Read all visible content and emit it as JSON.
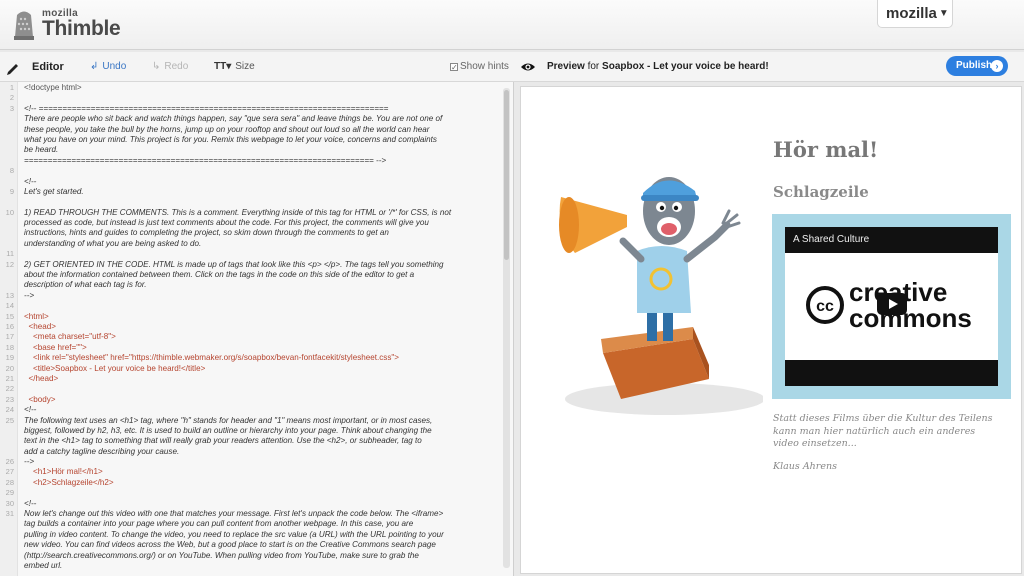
{
  "brand": {
    "small": "mozilla",
    "big": "Thimble",
    "menu": "mozilla"
  },
  "editor_toolbar": {
    "title": "Editor",
    "undo": "Undo",
    "redo": "Redo",
    "size": "Size",
    "size_glyph": "TT▾",
    "hints": "Show hints",
    "hints_checked": true
  },
  "preview_toolbar": {
    "label": "Preview",
    "for": "for",
    "page": "Soapbox - Let your voice be heard!",
    "publish": "Publish"
  },
  "code_lines": [
    {
      "n": "1",
      "text": "<!doctype html>",
      "kind": "plain"
    },
    {
      "n": "2",
      "text": "",
      "kind": "plain"
    },
    {
      "n": "3",
      "text": "<!-- ==========================================================================",
      "kind": "comment"
    },
    {
      "n": "",
      "text": "There are people who sit back and watch things happen, say \"que sera sera\" and leave things be. You are not one of",
      "kind": "comment"
    },
    {
      "n": "",
      "text": "these people, you take the bull by the horns, jump up on your rooftop and shout out loud so all the world can hear",
      "kind": "comment"
    },
    {
      "n": "",
      "text": "what you have on your mind. This project is for you. Remix this webpage to let your voice, concerns and complaints",
      "kind": "comment"
    },
    {
      "n": "",
      "text": "be heard.",
      "kind": "comment"
    },
    {
      "n": "",
      "text": "========================================================================== -->",
      "kind": "comment"
    },
    {
      "n": "8",
      "text": "",
      "kind": "plain"
    },
    {
      "n": "",
      "text": "<!--",
      "kind": "comment"
    },
    {
      "n": "9",
      "text": "Let's get started.",
      "kind": "comment"
    },
    {
      "n": "",
      "text": "",
      "kind": "plain"
    },
    {
      "n": "10",
      "text": "1) READ THROUGH THE COMMENTS. This is a comment. Everything inside of this tag for HTML or '/*' for CSS, is not",
      "kind": "comment"
    },
    {
      "n": "",
      "text": "processed as code, but instead is just text comments about the code. For this project, the comments will give you",
      "kind": "comment"
    },
    {
      "n": "",
      "text": "instructions, hints and guides to completing the project, so skim down through the comments to get an",
      "kind": "comment"
    },
    {
      "n": "",
      "text": "understanding of what you are being asked to do.",
      "kind": "comment"
    },
    {
      "n": "11",
      "text": "",
      "kind": "plain"
    },
    {
      "n": "12",
      "text": "2) GET ORIENTED IN THE CODE. HTML is made up of tags that look like this <p> </p>. The tags tell you something",
      "kind": "comment"
    },
    {
      "n": "",
      "text": "about the information contained between them. Click on the tags in the code on this side of the editor to get a",
      "kind": "comment"
    },
    {
      "n": "",
      "text": "description of what each tag is for.",
      "kind": "comment"
    },
    {
      "n": "13",
      "text": "-->",
      "kind": "comment"
    },
    {
      "n": "14",
      "text": "",
      "kind": "plain"
    },
    {
      "n": "15",
      "text": "<html>",
      "kind": "tag"
    },
    {
      "n": "16",
      "text": "  <head>",
      "kind": "tag"
    },
    {
      "n": "17",
      "text": "    <meta charset=\"utf-8\">",
      "kind": "tag"
    },
    {
      "n": "18",
      "text": "    <base href=\"\">",
      "kind": "tag"
    },
    {
      "n": "19",
      "text": "    <link rel=\"stylesheet\" href=\"https://thimble.webmaker.org/s/soapbox/bevan-fontfacekit/stylesheet.css\">",
      "kind": "tag"
    },
    {
      "n": "20",
      "text": "    <title>Soapbox - Let your voice be heard!</title>",
      "kind": "tag"
    },
    {
      "n": "21",
      "text": "  </head>",
      "kind": "tag"
    },
    {
      "n": "22",
      "text": "",
      "kind": "plain"
    },
    {
      "n": "23",
      "text": "  <body>",
      "kind": "tag"
    },
    {
      "n": "24",
      "text": "<!--",
      "kind": "comment"
    },
    {
      "n": "25",
      "text": "The following text uses an <h1> tag, where \"h\" stands for header and \"1\" means most important, or in most cases,",
      "kind": "comment"
    },
    {
      "n": "",
      "text": "biggest, followed by h2, h3, etc. It is used to build an outline or hierarchy into your page. Think about changing the",
      "kind": "comment"
    },
    {
      "n": "",
      "text": "text in the <h1> tag to something that will really grab your readers attention. Use the <h2>, or subheader, tag to",
      "kind": "comment"
    },
    {
      "n": "",
      "text": "add a catchy tagline describing your cause.",
      "kind": "comment"
    },
    {
      "n": "26",
      "text": "-->",
      "kind": "comment"
    },
    {
      "n": "27",
      "text": "    <h1>Hör mal!</h1>",
      "kind": "tag"
    },
    {
      "n": "28",
      "text": "    <h2>Schlagzeile</h2>",
      "kind": "tag"
    },
    {
      "n": "29",
      "text": "",
      "kind": "plain"
    },
    {
      "n": "30",
      "text": "<!--",
      "kind": "comment"
    },
    {
      "n": "31",
      "text": "Now let's change out this video with one that matches your message. First let's unpack the code below. The <iframe>",
      "kind": "comment"
    },
    {
      "n": "",
      "text": "tag builds a container into your page where you can pull content from another webpage. In this case, you are",
      "kind": "comment"
    },
    {
      "n": "",
      "text": "pulling in video content. To change the video, you need to replace the src value (a URL) with the URL pointing to your",
      "kind": "comment"
    },
    {
      "n": "",
      "text": "new video. You can find videos across the Web, but a good place to start is on the Creative Commons search page",
      "kind": "comment"
    },
    {
      "n": "",
      "text": "(http://search.creativecommons.org/) or on YouTube. When pulling video from YouTube, make sure to grab the",
      "kind": "comment"
    },
    {
      "n": "",
      "text": "embed url.",
      "kind": "comment"
    }
  ],
  "preview": {
    "h1": "Hör mal!",
    "h2": "Schlagzeile",
    "video_title": "A Shared Culture",
    "cc_line1": "creative",
    "cc_line2": "commons",
    "cc_mark": "cc",
    "caption": "Statt dieses Films über die Kultur des Teilens kann man hier natürlich auch ein anderes video einsetzen...",
    "author": "Klaus Ahrens"
  },
  "colors": {
    "accent": "#2d7fe0",
    "frame": "#aad7e6",
    "megaphone": "#f2a23a",
    "box": "#c8662a",
    "shirt": "#9fd0ea",
    "cap": "#4f9fdc"
  },
  "icons": [
    "thimble-logo-icon",
    "pencil-icon",
    "undo-icon",
    "redo-icon",
    "text-size-icon",
    "checkbox-icon",
    "eye-icon",
    "chevron-right-icon",
    "chevron-down-icon",
    "play-icon"
  ]
}
